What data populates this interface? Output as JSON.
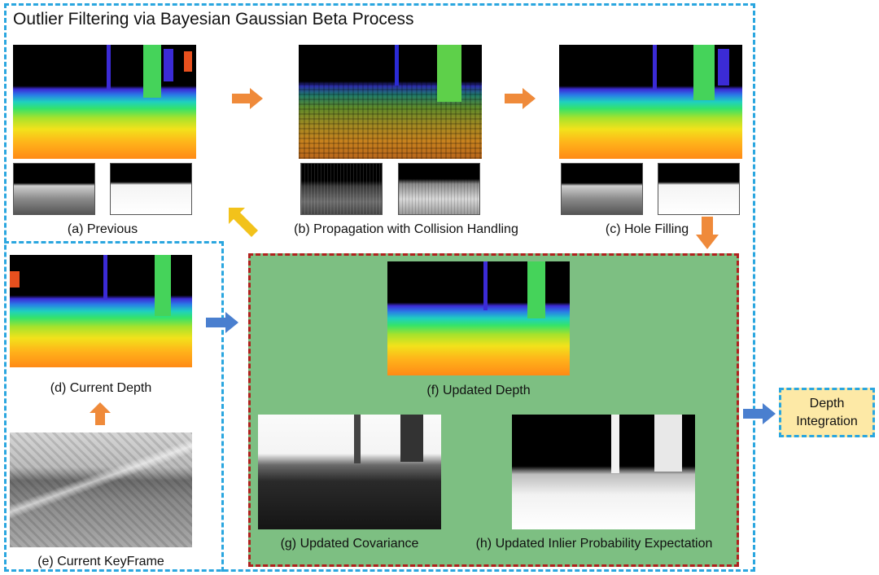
{
  "title": "Outlier Filtering via Bayesian Gaussian Beta Process",
  "panels": {
    "a": "(a) Previous",
    "b": "(b) Propagation with Collision Handling",
    "c": "(c) Hole Filling",
    "d": "(d) Current Depth",
    "e": "(e) Current KeyFrame",
    "f": "(f) Updated Depth",
    "g": "(g) Updated Covariance",
    "h": "(h) Updated Inlier Probability Expectation"
  },
  "output": {
    "line1": "Depth",
    "line2": "Integration"
  },
  "colors": {
    "dashed_border": "#2aa6df",
    "update_box_fill": "#7dbf82",
    "update_box_border": "#b0211d",
    "orange_arrow": "#ef8a3a",
    "blue_arrow": "#4a7fcf",
    "yellow_arrow": "#f2c21b",
    "output_fill": "#fde9a6"
  },
  "arrow_icons": [
    "arrow-right-orange",
    "arrow-down-orange",
    "arrow-up-orange",
    "arrow-upleft-yellow",
    "arrow-right-blue"
  ]
}
